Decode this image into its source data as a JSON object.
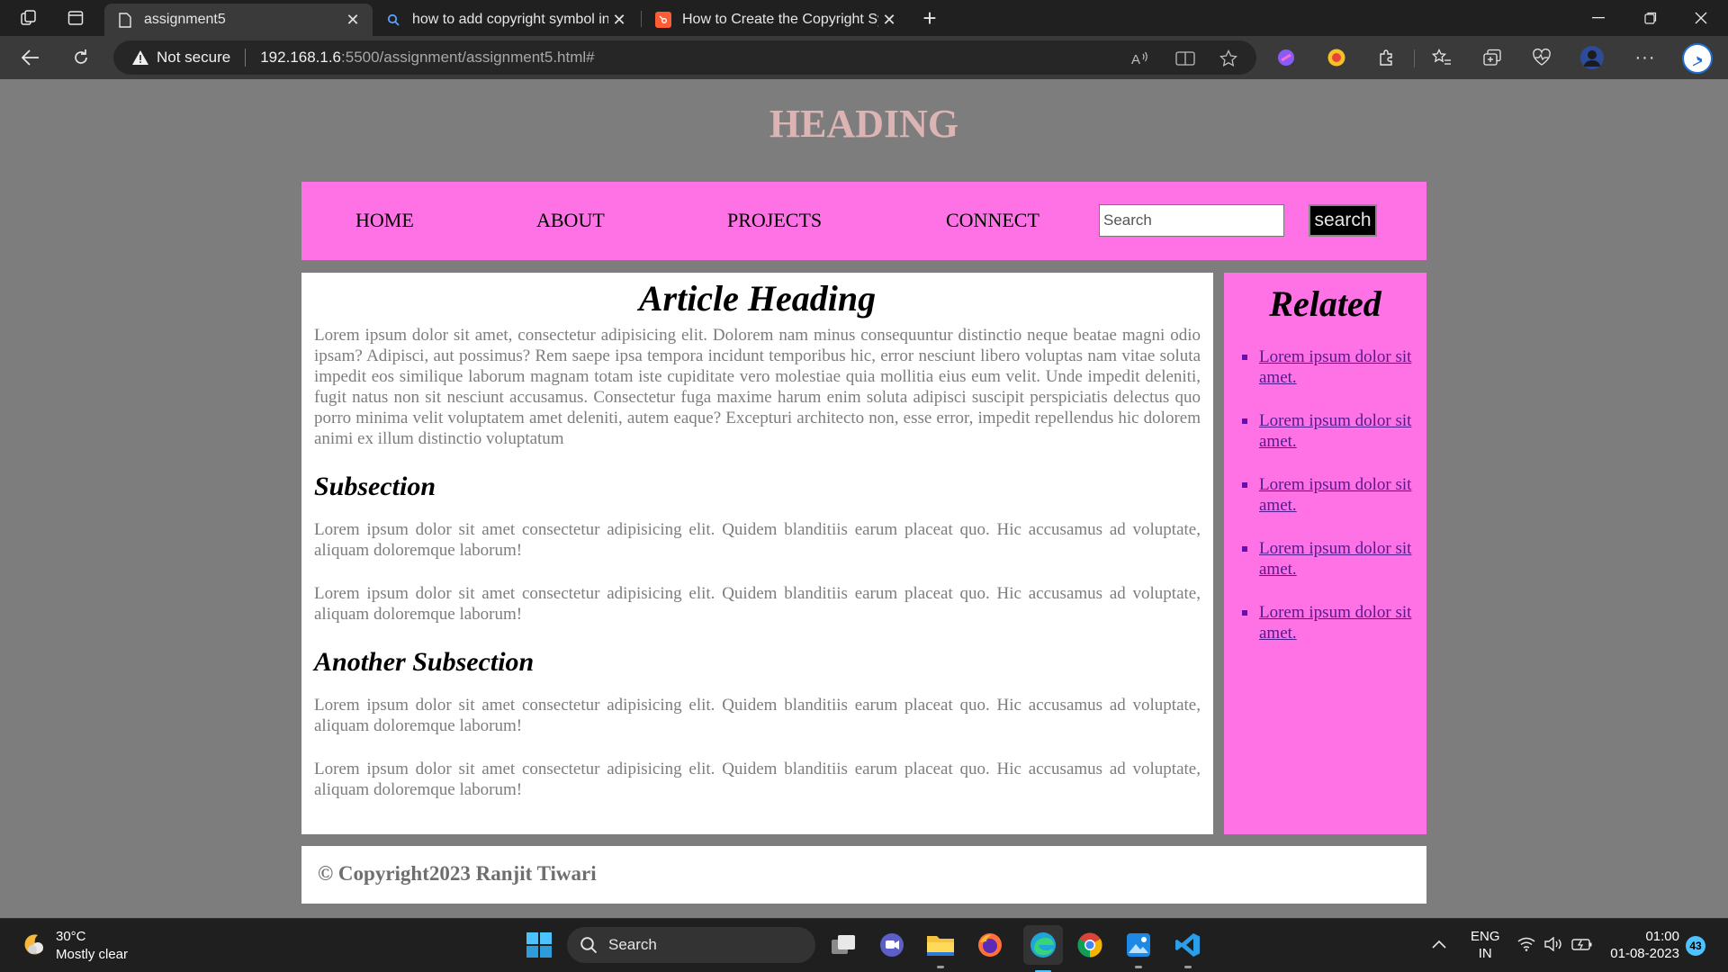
{
  "browser": {
    "tabs": [
      {
        "label": "assignment5",
        "icon": "page-icon",
        "active": true
      },
      {
        "label": "how to add copyright symbol in",
        "icon": "search-icon",
        "active": false
      },
      {
        "label": "How to Create the Copyright Sym",
        "icon": "hubspot-icon",
        "active": false
      }
    ],
    "address": {
      "security_label": "Not secure",
      "host": "192.168.1.6",
      "path": ":5500/assignment/assignment5.html#"
    }
  },
  "page": {
    "heading": "HEADING",
    "nav": {
      "links": [
        "HOME",
        "ABOUT",
        "PROJECTS",
        "CONNECT"
      ],
      "search_placeholder": "Search",
      "search_button": "search"
    },
    "article": {
      "title": "Article Heading",
      "intro": "Lorem ipsum dolor sit amet, consectetur adipisicing elit. Dolorem nam minus consequuntur distinctio neque beatae magni odio ipsam? Adipisci, aut possimus? Rem saepe ipsa tempora incidunt temporibus hic, error nesciunt libero voluptas nam vitae soluta impedit eos similique laborum magnam totam iste cupiditate vero molestiae quia mollitia eius eum velit. Unde impedit deleniti, fugit natus non sit nesciunt accusamus. Consectetur fuga maxime harum enim soluta adipisci suscipit perspiciatis delectus quo porro minima velit voluptatem amet deleniti, autem eaque? Excepturi architecto non, esse error, impedit repellendus hic dolorem animi ex illum distinctio voluptatum",
      "subsection1": {
        "title": "Subsection",
        "paragraphs": [
          "Lorem ipsum dolor sit amet consectetur adipisicing elit. Quidem blanditiis earum placeat quo. Hic accusamus ad voluptate, aliquam doloremque laborum!",
          "Lorem ipsum dolor sit amet consectetur adipisicing elit. Quidem blanditiis earum placeat quo. Hic accusamus ad voluptate, aliquam doloremque laborum!"
        ]
      },
      "subsection2": {
        "title": "Another Subsection",
        "paragraphs": [
          "Lorem ipsum dolor sit amet consectetur adipisicing elit. Quidem blanditiis earum placeat quo. Hic accusamus ad voluptate, aliquam doloremque laborum!",
          "Lorem ipsum dolor sit amet consectetur adipisicing elit. Quidem blanditiis earum placeat quo. Hic accusamus ad voluptate, aliquam doloremque laborum!"
        ]
      }
    },
    "related": {
      "title": "Related",
      "links": [
        "Lorem ipsum dolor sit amet.",
        "Lorem ipsum dolor sit amet.",
        "Lorem ipsum dolor sit amet.",
        "Lorem ipsum dolor sit amet.",
        "Lorem ipsum dolor sit amet."
      ]
    },
    "footer": "© Copyright2023 Ranjit Tiwari"
  },
  "taskbar": {
    "weather": {
      "temp": "30°C",
      "condition": "Mostly clear"
    },
    "search_label": "Search",
    "language": {
      "line1": "ENG",
      "line2": "IN"
    },
    "clock": {
      "time": "01:00",
      "date": "01-08-2023"
    },
    "notification_count": "43"
  },
  "colors": {
    "page_bg": "#7d7d7d",
    "accent_pink": "#ff72e6",
    "heading_pink": "#ddb4b4"
  }
}
